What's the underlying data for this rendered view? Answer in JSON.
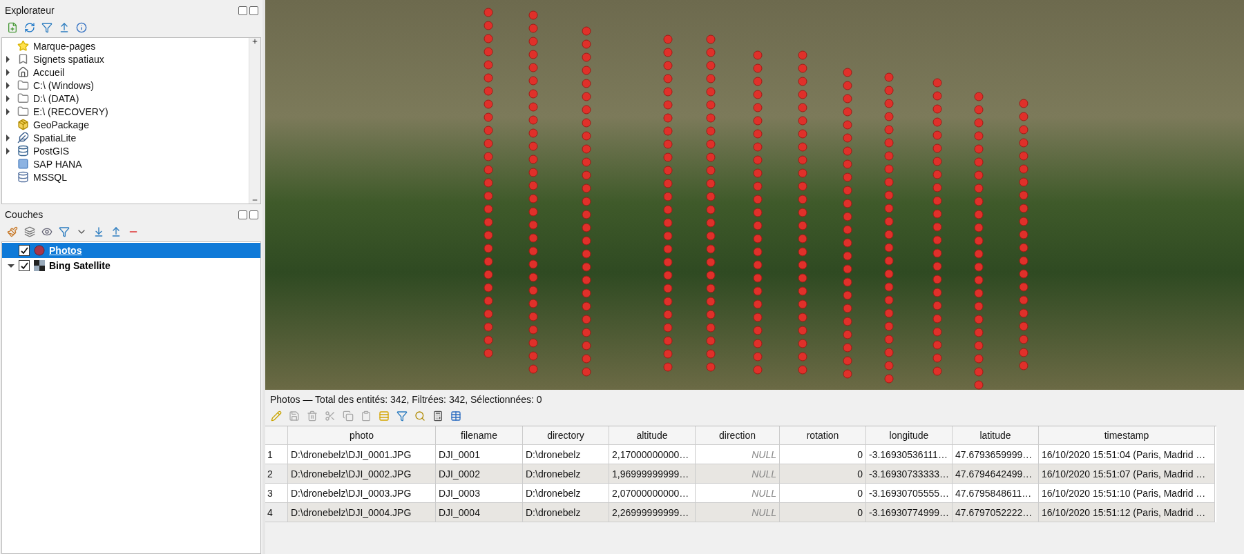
{
  "explorer": {
    "title": "Explorateur",
    "items": [
      {
        "label": "Marque-pages",
        "expandable": false
      },
      {
        "label": "Signets spatiaux",
        "expandable": true
      },
      {
        "label": "Accueil",
        "expandable": true
      },
      {
        "label": "C:\\ (Windows)",
        "expandable": true
      },
      {
        "label": "D:\\ (DATA)",
        "expandable": true
      },
      {
        "label": "E:\\ (RECOVERY)",
        "expandable": true
      },
      {
        "label": "GeoPackage",
        "expandable": false
      },
      {
        "label": "SpatiaLite",
        "expandable": true
      },
      {
        "label": "PostGIS",
        "expandable": true
      },
      {
        "label": "SAP HANA",
        "expandable": false
      },
      {
        "label": "MSSQL",
        "expandable": false
      }
    ]
  },
  "layers": {
    "title": "Couches",
    "items": [
      {
        "name": "Photos",
        "kind": "point",
        "checked": true,
        "selected": true,
        "expanded": false
      },
      {
        "name": "Bing Satellite",
        "kind": "raster",
        "checked": true,
        "selected": false,
        "expanded": true
      }
    ]
  },
  "attribute_table": {
    "title": "Photos — Total des entités: 342, Filtrées: 342, Sélectionnées: 0",
    "columns": [
      "photo",
      "filename",
      "directory",
      "altitude",
      "direction",
      "rotation",
      "longitude",
      "latitude",
      "timestamp"
    ],
    "rows": [
      {
        "number": "1",
        "cells": [
          "D:\\dronebelz\\DJI_0001.JPG",
          "DJI_0001",
          "D:\\dronebelz",
          "2,17000000000…",
          "NULL",
          "0",
          "-3.16930536111…",
          "47.6793659999…",
          "16/10/2020 15:51:04 (Paris, Madrid …"
        ]
      },
      {
        "number": "2",
        "cells": [
          "D:\\dronebelz\\DJI_0002.JPG",
          "DJI_0002",
          "D:\\dronebelz",
          "1,96999999999…",
          "NULL",
          "0",
          "-3.16930733333…",
          "47.6794642499…",
          "16/10/2020 15:51:07 (Paris, Madrid …"
        ]
      },
      {
        "number": "3",
        "cells": [
          "D:\\dronebelz\\DJI_0003.JPG",
          "DJI_0003",
          "D:\\dronebelz",
          "2,07000000000…",
          "NULL",
          "0",
          "-3.16930705555…",
          "47.6795848611…",
          "16/10/2020 15:51:10 (Paris, Madrid …"
        ]
      },
      {
        "number": "4",
        "cells": [
          "D:\\dronebelz\\DJI_0004.JPG",
          "DJI_0004",
          "D:\\dronebelz",
          "2,26999999999…",
          "NULL",
          "0",
          "-3.16930774999…",
          "47.6797052222…",
          "16/10/2020 15:51:12 (Paris, Madrid …"
        ]
      }
    ]
  }
}
